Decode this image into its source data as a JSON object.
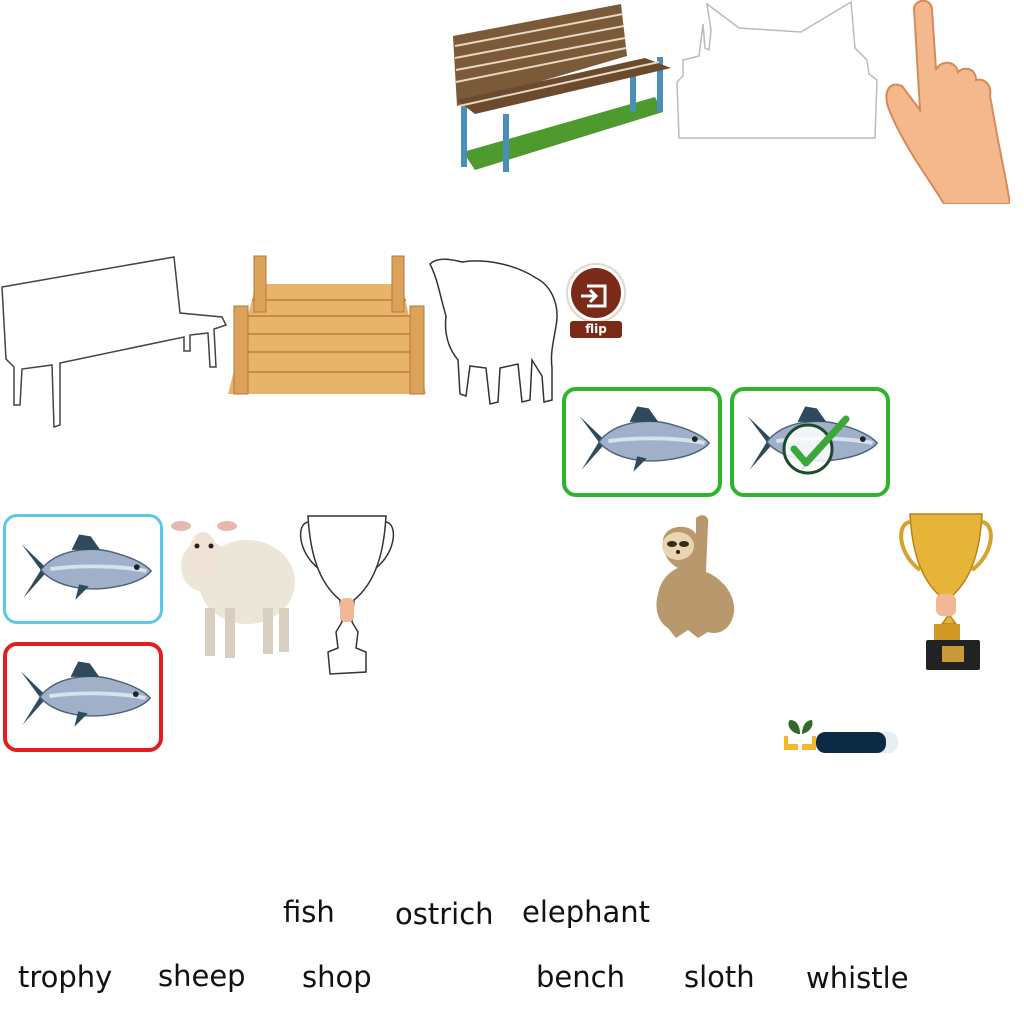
{
  "game": {
    "flip_label": "flip",
    "words_row1": [
      "fish",
      "ostrich",
      "elephant"
    ],
    "words_row2": [
      "trophy",
      "sheep",
      "shop",
      "bench",
      "sloth",
      "whistle"
    ]
  },
  "progress": {
    "fraction": 0.85,
    "color": "#0d2a45"
  },
  "colors": {
    "card_correct": "#2db52d",
    "card_selected": "#5cc8e8",
    "card_wrong": "#e41e1e",
    "flip_button": "#7a2a17"
  },
  "icons": {
    "bench": "bench-picture",
    "bench_outline": "bench-outline",
    "pier": "wooden-pier-picture",
    "sheep": "sheep-picture",
    "sheep_outline": "sheep-outline",
    "fish": "fish-picture",
    "sloth": "sloth-picture",
    "trophy": "trophy-picture",
    "trophy_outline": "trophy-outline",
    "hand": "pointing-hand",
    "check": "check-icon",
    "logo": "plant-hands-logo"
  }
}
